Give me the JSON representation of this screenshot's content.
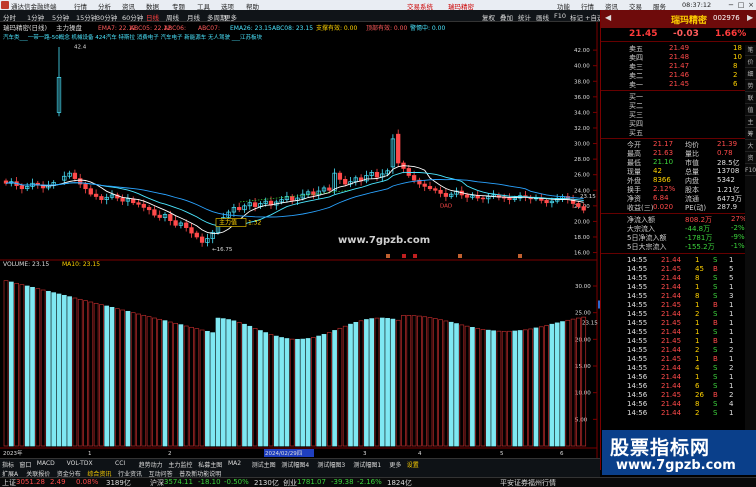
{
  "titlebar": {
    "app_name": "通达信金融终端",
    "menus": [
      "行情",
      "分析",
      "资讯",
      "数据",
      "专题",
      "工具",
      "选项",
      "帮助"
    ],
    "links": [
      "交易系统",
      "瑞玛精密"
    ],
    "right": [
      "功能",
      "行情",
      "资讯",
      "交易",
      "服务"
    ]
  },
  "toolbar": {
    "periods": [
      "分时",
      "1分钟",
      "5分钟",
      "15分钟",
      "30分钟",
      "60分钟",
      "日线",
      "周线",
      "月线",
      "多周期",
      "更多"
    ],
    "tools": [
      "复权",
      "叠加",
      "统计",
      "画线",
      "F10",
      "标记",
      "+自选",
      "返回"
    ]
  },
  "kline": {
    "title": "瑞玛精密(日线)",
    "indicator": "主力操盘",
    "ema_labels": [
      {
        "text": "EMA7: 22.12",
        "color": "#ff5b5b"
      },
      {
        "text": "ABC05: 22.12",
        "color": "#ff5b5b"
      },
      {
        "text": "ABC06:",
        "color": "#ff5b5b"
      },
      {
        "text": "ABC07:",
        "color": "#ff5b5b"
      },
      {
        "text": "EMA26: 23.15",
        "color": "#4be6ff"
      },
      {
        "text": "ABC08: 23.15",
        "color": "#4be6ff"
      },
      {
        "text": "支撑有效: 0.00",
        "color": "#ffd200"
      },
      {
        "text": "顶部有效: 0.00",
        "color": "#ff5b5b"
      },
      {
        "text": "警惕中: 0.00",
        "color": "#4be6ff"
      }
    ],
    "concept_tags": "汽车类___一带一路-50概念 机械设备 424汽车 特斯拉 消费电子 汽车电子 新能源车 无人驾驶 ___江苏板块",
    "y_ticks": [
      "42.00",
      "40.00",
      "38.00",
      "36.00",
      "34.00",
      "32.00",
      "30.00",
      "28.00",
      "26.00",
      "24.00",
      "22.00",
      "20.00",
      "18.00",
      "16.00"
    ],
    "annotations": {
      "zhuli": "主力值",
      "zhuli_val": "1.32",
      "low": "16.75",
      "last": "23.15",
      "dad": "DAD",
      "top": "42.4"
    }
  },
  "volume": {
    "title": "VOLUME: 23.15",
    "ma": "MA10: 23.15",
    "y_ticks": [
      "30.00",
      "25.00",
      "20.00",
      "15.00",
      "10.00",
      "5.00"
    ],
    "marker": "26.53",
    "last": "23.15"
  },
  "dates": [
    "2023年",
    "1",
    "2",
    "2024/02/29四",
    "3",
    "4",
    "5",
    "6"
  ],
  "tabs": [
    "指标",
    "窗口",
    "MACD",
    "VOL-TDX",
    "CCI",
    "趋势动力",
    "主力监控",
    "私募主图",
    "MA2",
    "测试主图",
    "测试幅图4",
    "测试幅图3",
    "测试幅图1",
    "更多",
    "设置"
  ],
  "tabs2": [
    "扩展A",
    "关联报价",
    "资金分布",
    "综合资讯",
    "行业资讯",
    "互动问答",
    "普及新功能说明"
  ],
  "quote": {
    "name": "瑞玛精密",
    "code": "002976",
    "price": "21.45",
    "change": "-0.03",
    "pct": "1.66%",
    "asks": [
      {
        "label": "卖五",
        "price": "21.49",
        "vol": "18"
      },
      {
        "label": "卖四",
        "price": "21.48",
        "vol": "10"
      },
      {
        "label": "卖三",
        "price": "21.47",
        "vol": "8"
      },
      {
        "label": "卖二",
        "price": "21.46",
        "vol": "2"
      },
      {
        "label": "卖一",
        "price": "21.45",
        "vol": "6"
      }
    ],
    "bids": [
      {
        "label": "买一",
        "price": "",
        "vol": ""
      },
      {
        "label": "买二",
        "price": "",
        "vol": ""
      },
      {
        "label": "买三",
        "price": "",
        "vol": ""
      },
      {
        "label": "买四",
        "price": "",
        "vol": ""
      },
      {
        "label": "买五",
        "price": "",
        "vol": ""
      }
    ],
    "stats": [
      {
        "l1": "今开",
        "v1": "21.17",
        "l2": "均价",
        "v2": "21.39"
      },
      {
        "l1": "最高",
        "v1": "21.63",
        "l2": "量比",
        "v2": "0.78"
      },
      {
        "l1": "最低",
        "v1": "21.10",
        "l2": "市值",
        "v2": "28.5亿"
      },
      {
        "l1": "现量",
        "v1": "42",
        "l2": "总量",
        "v2": "13708"
      },
      {
        "l1": "外盘",
        "v1": "8366",
        "l2": "内盘",
        "v2": "5342"
      },
      {
        "l1": "换手",
        "v1": "2.12%",
        "l2": "股本",
        "v2": "1.21亿"
      },
      {
        "l1": "净资",
        "v1": "6.84",
        "l2": "流通",
        "v2": "6473万"
      },
      {
        "l1": "收益(三)",
        "v1": "0.020",
        "l2": "PE(动)",
        "v2": "287.9"
      }
    ],
    "flows": [
      {
        "label": "净流入额",
        "value": "808.2万",
        "pct": "27%"
      },
      {
        "label": "大宗流入",
        "value": "-44.8万",
        "pct": "-2%"
      },
      {
        "label": "5日净流入额",
        "value": "-1781万",
        "pct": "-9%"
      },
      {
        "label": "5日大宗流入",
        "value": "-155.2万",
        "pct": "-1%"
      }
    ],
    "ticks": [
      {
        "t": "14:55",
        "p": "21.44",
        "v": "1",
        "n": "S",
        "c": "1"
      },
      {
        "t": "14:55",
        "p": "21.45",
        "v": "45",
        "n": "B",
        "c": "5"
      },
      {
        "t": "14:55",
        "p": "21.44",
        "v": "8",
        "n": "S",
        "c": "5"
      },
      {
        "t": "14:55",
        "p": "21.44",
        "v": "1",
        "n": "S",
        "c": "1"
      },
      {
        "t": "14:55",
        "p": "21.44",
        "v": "8",
        "n": "S",
        "c": "3"
      },
      {
        "t": "14:55",
        "p": "21.45",
        "v": "1",
        "n": "B",
        "c": "1"
      },
      {
        "t": "14:55",
        "p": "21.44",
        "v": "2",
        "n": "S",
        "c": "1"
      },
      {
        "t": "14:55",
        "p": "21.45",
        "v": "1",
        "n": "B",
        "c": "1"
      },
      {
        "t": "14:55",
        "p": "21.44",
        "v": "1",
        "n": "S",
        "c": "1"
      },
      {
        "t": "14:55",
        "p": "21.45",
        "v": "1",
        "n": "B",
        "c": "1"
      },
      {
        "t": "14:55",
        "p": "21.44",
        "v": "2",
        "n": "S",
        "c": "2"
      },
      {
        "t": "14:55",
        "p": "21.45",
        "v": "1",
        "n": "B",
        "c": "1"
      },
      {
        "t": "14:55",
        "p": "21.44",
        "v": "4",
        "n": "S",
        "c": "2"
      },
      {
        "t": "14:56",
        "p": "21.44",
        "v": "1",
        "n": "S",
        "c": "1"
      },
      {
        "t": "14:56",
        "p": "21.44",
        "v": "6",
        "n": "S",
        "c": "1"
      },
      {
        "t": "14:56",
        "p": "21.45",
        "v": "26",
        "n": "B",
        "c": "2"
      },
      {
        "t": "14:56",
        "p": "21.44",
        "v": "8",
        "n": "S",
        "c": "4"
      },
      {
        "t": "14:56",
        "p": "21.44",
        "v": "2",
        "n": "S",
        "c": "1"
      }
    ]
  },
  "side_tabs": [
    "笔",
    "价",
    "细",
    "势",
    "联",
    "值",
    "主",
    "筹",
    "大",
    "资",
    "F10"
  ],
  "status": [
    {
      "label": "上证",
      "v1": "3051.28",
      "v2": "2.49",
      "v3": "0.08%",
      "v4": "3189亿"
    },
    {
      "label": "沪深",
      "v1": "3574.11",
      "v2": "-18.10",
      "v3": "-0.50%",
      "v4": "2130亿"
    },
    {
      "label": "创业",
      "v1": "1781.07",
      "v2": "-39.38",
      "v3": "-2.16%",
      "v4": "1824亿"
    }
  ],
  "status_right": "平安证券福州行情",
  "clock": "08:37:12",
  "watermark": "www.7gpzb.com",
  "ad": {
    "line1": "股票指标网",
    "line2": "www.7gpzb.com"
  }
}
